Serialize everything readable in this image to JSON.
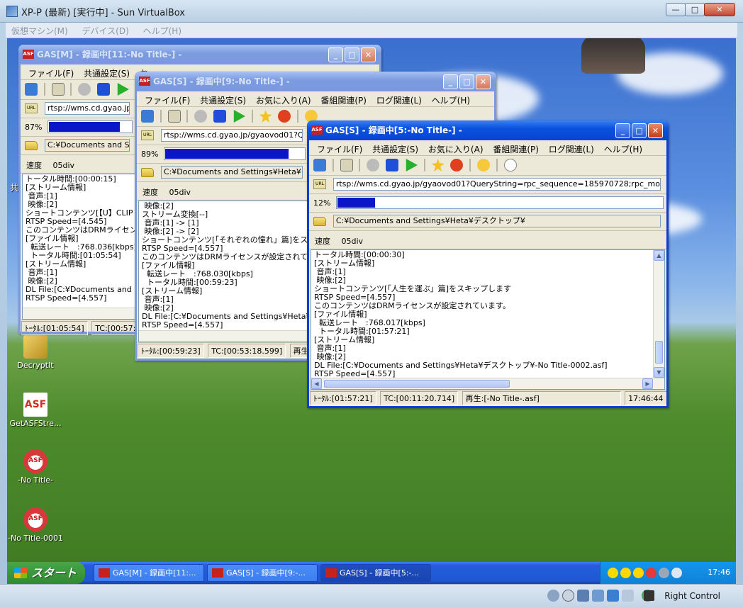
{
  "host": {
    "title": "XP-P (最新) [実行中] - Sun VirtualBox",
    "menu": [
      "仮想マシン(M)",
      "デバイス(D)",
      "ヘルプ(H)"
    ],
    "buttons": {
      "minimize": "—",
      "maximize": "□",
      "close": "✕"
    },
    "status_label": "Right Control"
  },
  "desktop_icons": [
    {
      "label": "DecryptIt",
      "icon": "tool-icon"
    },
    {
      "label": "GetASFStre...",
      "icon": "asf-app-icon"
    },
    {
      "label": "-No Title-",
      "icon": "asf-file-icon"
    },
    {
      "label": "-No Title-0001",
      "icon": "asf-file-icon"
    }
  ],
  "stray_char": "共",
  "menu_items": [
    "ファイル(F)",
    "共通設定(S)",
    "お気に入り(A)",
    "番組関連(P)",
    "ログ関連(L)",
    "ヘルプ(H)"
  ],
  "windows": [
    {
      "id": "w1",
      "title": "GAS[M] - 録画中[11:-No Title-] -",
      "menu_visible": [
        "ファイル(F)",
        "共通設定(S)",
        "お"
      ],
      "url": "rtsp://wms.cd.gyao.jp/g",
      "progress_pct": "87%",
      "progress": 0.87,
      "folder": "C:¥Documents and Sett",
      "speed_label": "速度",
      "speed_value": "05div",
      "log": "トータル時間:[00:00:15]\n[ストリーム情報]\n 音声:[1]\n 映像:[2]\nショートコンテンツ[【U】CLIP RIN\nRTSP Speed=[4.545]\nこのコンテンツはDRMライセン\n[ファイル情報]\n  転送レート　:768.036[kbps]\n  トータル時間:[01:05:54]\n[ストリーム情報]\n 音声:[1]\n 映像:[2]\nDL File:[C:¥Documents and Se\nRTSP Speed=[4.557]",
      "status": [
        "ﾄｰﾀﾙ:[01:05:54]",
        "TC:[00:57:5"
      ]
    },
    {
      "id": "w2",
      "title": "GAS[S] - 録画中[9:-No Title-] -",
      "url": "rtsp://wms.cd.gyao.jp/gyaovod01?Query",
      "progress_pct": "89%",
      "progress": 0.89,
      "folder": "C:¥Documents and Settings¥Heta¥デスク",
      "speed_label": "速度",
      "speed_value": "05div",
      "log": " 映像:[2]\nストリーム変換[--]\n 音声:[1] -> [1]\n 映像:[2] -> [2]\nショートコンテンツ[「それぞれの憧れ」篇]をスキ\nRTSP Speed=[4.557]\nこのコンテンツはDRMライセンスが設定されて\n[ファイル情報]\n  転送レート　:768.030[kbps]\n  トータル時間:[00:59:23]\n[ストリーム情報]\n 音声:[1]\n 映像:[2]\nDL File:[C:¥Documents and Settings¥Heta¥デ\nRTSP Speed=[4.557]",
      "status": [
        "ﾄｰﾀﾙ:[00:59:23]",
        "TC:[00:53:18.599]",
        "再生:"
      ]
    },
    {
      "id": "w3",
      "title": "GAS[S] - 録画中[5:-No Title-] -",
      "url": "rtsp://wms.cd.gyao.jp/gyaovod01?QueryString=rpc_sequence=185970728;rpc_mode=p2p",
      "progress_pct": "12%",
      "progress": 0.12,
      "folder": "C:¥Documents and Settings¥Heta¥デスクトップ¥",
      "speed_label": "速度",
      "speed_value": "05div",
      "log": "トータル時間:[00:00:30]\n[ストリーム情報]\n 音声:[1]\n 映像:[2]\nショートコンテンツ[「人生を運ぶ」篇]をスキップします\nRTSP Speed=[4.557]\nこのコンテンツはDRMライセンスが設定されています。\n[ファイル情報]\n  転送レート　:768.017[kbps]\n  トータル時間:[01:57:21]\n[ストリーム情報]\n 音声:[1]\n 映像:[2]\nDL File:[C:¥Documents and Settings¥Heta¥デスクトップ¥-No Title-0002.asf]\nRTSP Speed=[4.557]",
      "status": [
        "ﾄｰﾀﾙ:[01:57:21]",
        "TC:[00:11:20.714]",
        "再生:[-No Title-.asf]",
        "17:46:44"
      ]
    }
  ],
  "taskbar": {
    "start": "スタート",
    "tasks": [
      "GAS[M] - 録画中[11:...",
      "GAS[S] - 録画中[9:-...",
      "GAS[S] - 録画中[5:-..."
    ],
    "clock": "17:46"
  },
  "colors": {
    "xp_title": "#0a51e0",
    "progress_fill": "#0a17c9",
    "taskbar": "#245edb",
    "start": "#318a31"
  }
}
